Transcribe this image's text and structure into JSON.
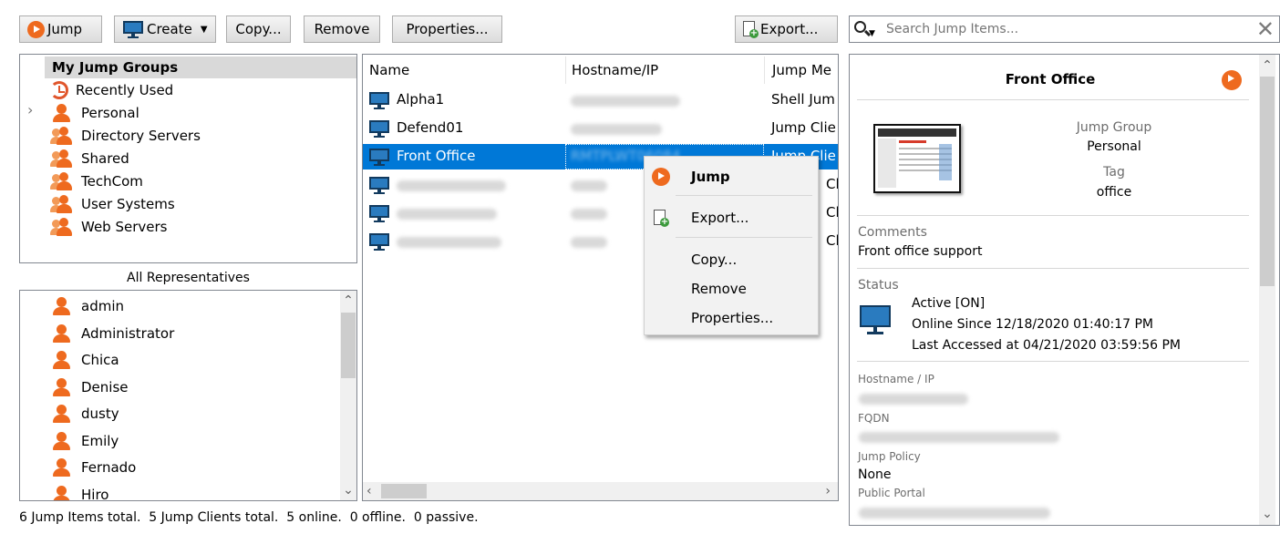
{
  "toolbar": {
    "jump_label": "Jump",
    "create_label": "Create",
    "copy_label": "Copy...",
    "remove_label": "Remove",
    "properties_label": "Properties...",
    "export_label": "Export...",
    "search_placeholder": "Search Jump Items..."
  },
  "groups": {
    "header": "My Jump Groups",
    "items": [
      {
        "label": "Recently Used",
        "icon": "clock-icon"
      },
      {
        "label": "Personal",
        "icon": "person-icon"
      },
      {
        "label": "Directory Servers",
        "icon": "group-icon"
      },
      {
        "label": "Shared",
        "icon": "group-icon"
      },
      {
        "label": "TechCom",
        "icon": "group-icon"
      },
      {
        "label": "User Systems",
        "icon": "group-icon"
      },
      {
        "label": "Web Servers",
        "icon": "group-icon"
      }
    ]
  },
  "representatives": {
    "header": "All Representatives",
    "items": [
      "admin",
      "Administrator",
      "Chica",
      "Denise",
      "dusty",
      "Emily",
      "Fernado",
      "Hiro"
    ]
  },
  "table": {
    "columns": [
      "Name",
      "Hostname/IP",
      "Jump Me"
    ],
    "rows": [
      {
        "name": "Alpha1",
        "method": "Shell Jum"
      },
      {
        "name": "Defend01",
        "method": "Jump Clie"
      },
      {
        "name": "Front Office",
        "host_visible": "RMTPLWT06084",
        "method": "Jump Clie"
      },
      {
        "name": "",
        "method": "Clie"
      },
      {
        "name": "",
        "method": "Clie"
      },
      {
        "name": "",
        "method": "Clie"
      }
    ]
  },
  "context_menu": {
    "jump": "Jump",
    "export": "Export...",
    "copy": "Copy...",
    "remove": "Remove",
    "properties": "Properties..."
  },
  "details": {
    "title": "Front Office",
    "jump_group_label": "Jump Group",
    "jump_group_value": "Personal",
    "tag_label": "Tag",
    "tag_value": "office",
    "comments_label": "Comments",
    "comments_value": "Front office support",
    "status_label": "Status",
    "status_active": "Active [ON]",
    "status_online": "Online Since 12/18/2020 01:40:17 PM",
    "status_accessed": "Last Accessed at 04/21/2020 03:59:56 PM",
    "hostname_label": "Hostname / IP",
    "fqdn_label": "FQDN",
    "policy_label": "Jump Policy",
    "policy_value": "None",
    "portal_label": "Public Portal"
  },
  "status_bar": "6 Jump Items total.  5 Jump Clients total.  5 online.  0 offline.  0 passive.",
  "colors": {
    "accent": "#ee6a1f",
    "selection": "#0078d7",
    "monitor": "#2a7bbf"
  }
}
